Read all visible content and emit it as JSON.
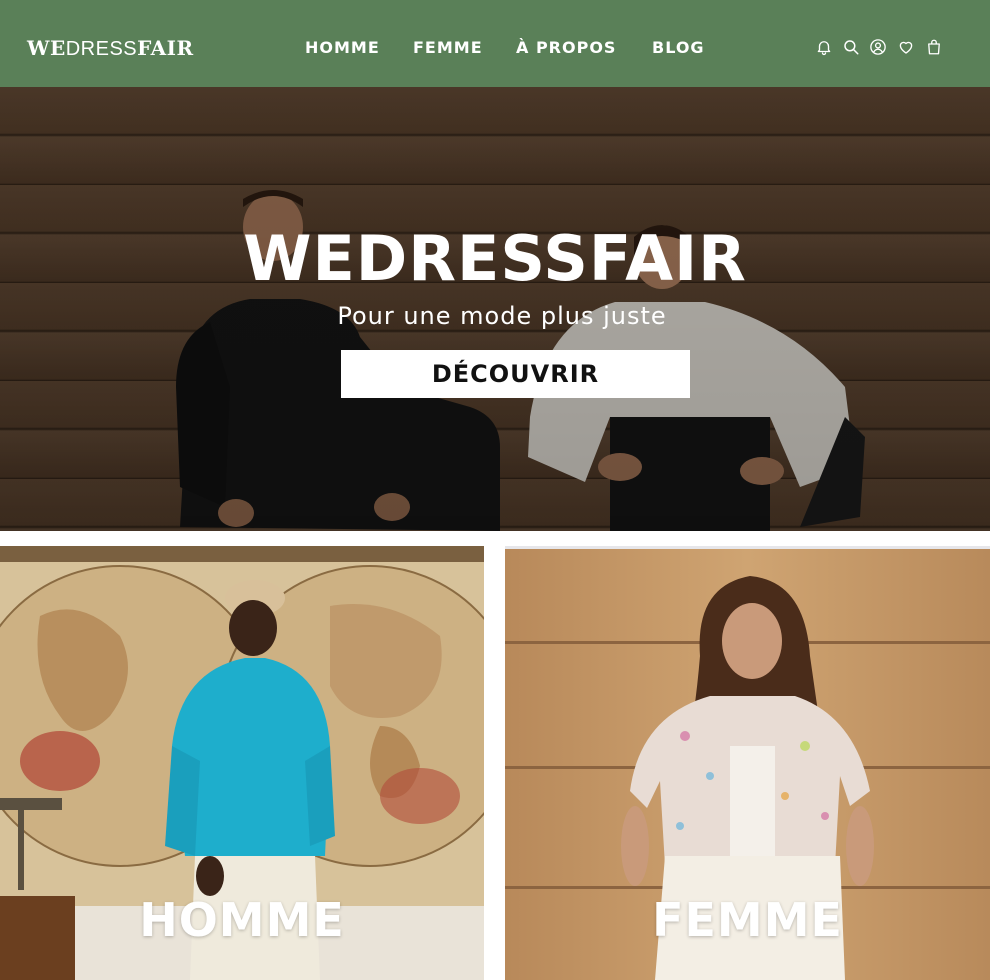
{
  "header": {
    "logo": {
      "we": "WE",
      "dress": "DRESS",
      "fair": "FAIR"
    },
    "nav": [
      {
        "label": "HOMME"
      },
      {
        "label": "FEMME"
      },
      {
        "label": "À PROPOS"
      },
      {
        "label": "BLOG"
      }
    ],
    "icons": [
      "bell-icon",
      "search-icon",
      "account-icon",
      "heart-icon",
      "bag-icon"
    ],
    "background_color": "#5a8058"
  },
  "hero": {
    "title": "WEDRESSFAIR",
    "subtitle": "Pour une mode plus juste",
    "cta_label": "DÉCOUVRIR"
  },
  "categories": [
    {
      "label": "HOMME"
    },
    {
      "label": "FEMME"
    }
  ]
}
